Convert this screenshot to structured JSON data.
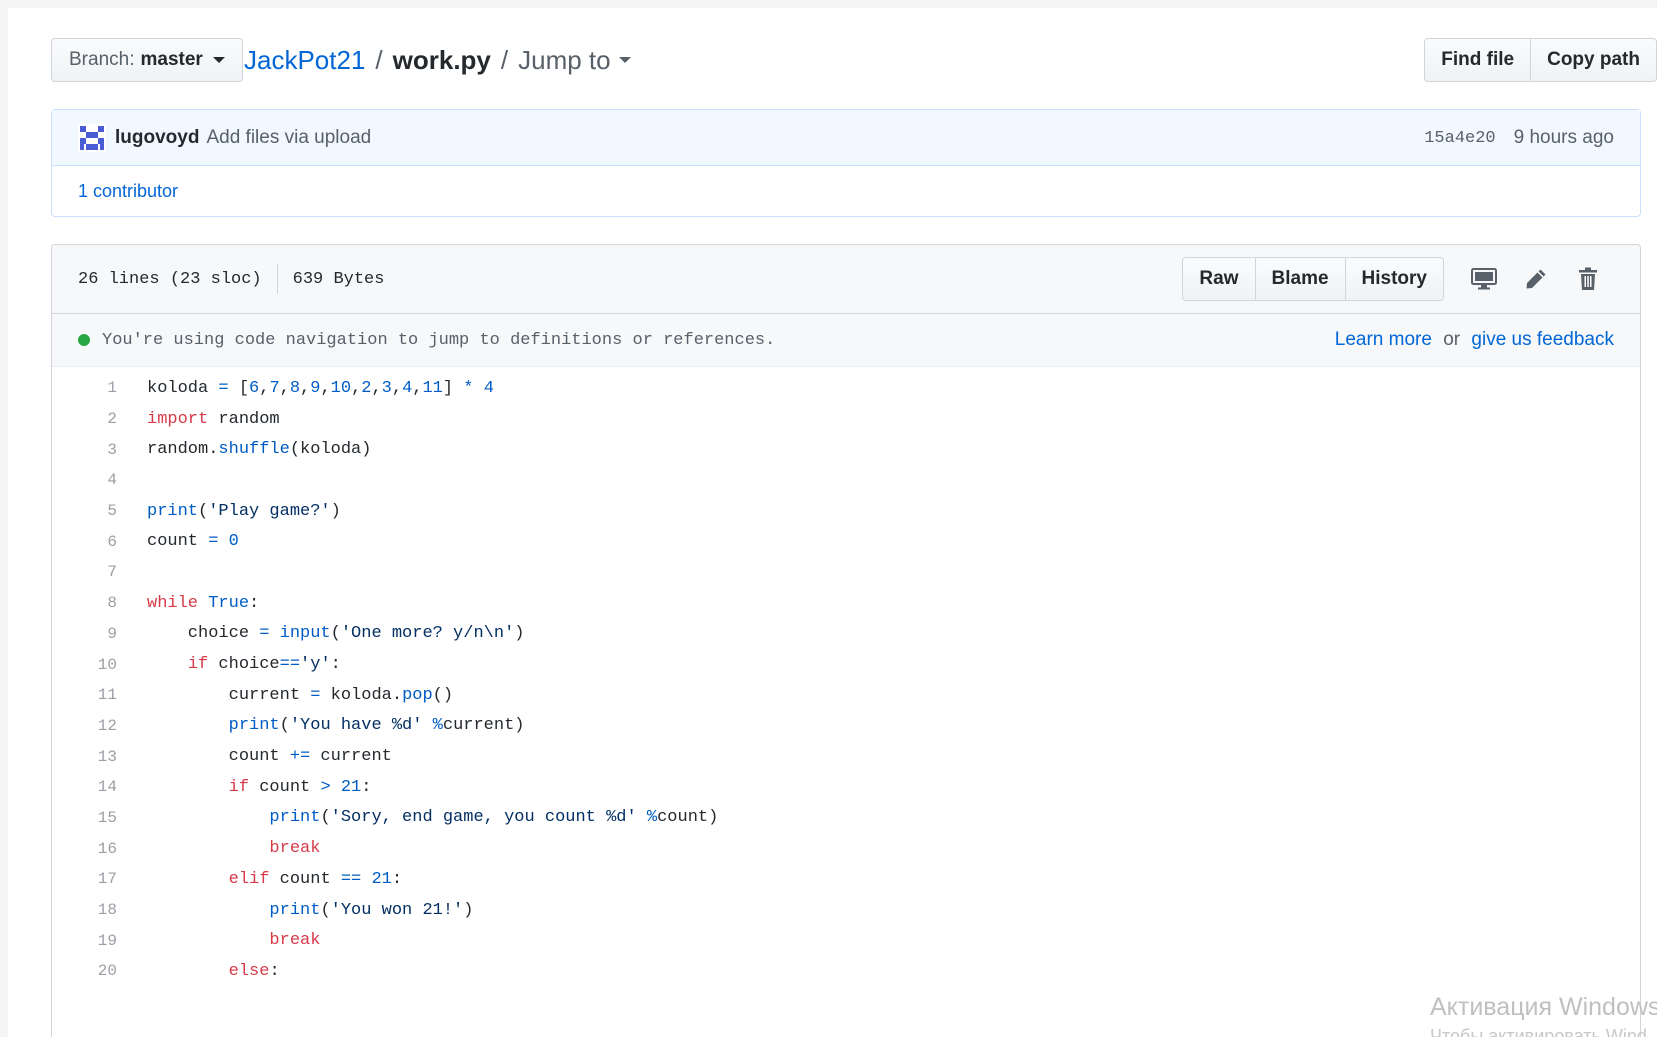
{
  "branch": {
    "label": "Branch:",
    "value": "master"
  },
  "breadcrumb": {
    "repo": "JackPot21",
    "sep1": "/",
    "file": "work.py",
    "sep2": "/",
    "jump": "Jump to"
  },
  "file_buttons": {
    "find": "Find file",
    "copy": "Copy path"
  },
  "commit": {
    "author": "lugovoyd",
    "message": "Add files via upload",
    "sha": "15a4e20",
    "time": "9 hours ago"
  },
  "contributors": "1 contributor",
  "file_info": {
    "lines": "26 lines (23 sloc)",
    "size": "639 Bytes"
  },
  "file_actions": {
    "raw": "Raw",
    "blame": "Blame",
    "history": "History"
  },
  "icons": {
    "desktop": "desktop-icon",
    "edit": "pencil-icon",
    "delete": "trash-icon"
  },
  "notice": {
    "text": "You're using code navigation to jump to definitions or references.",
    "learn": "Learn more",
    "or": "or",
    "feedback": "give us feedback"
  },
  "colors": {
    "link": "#0366d6",
    "keyword": "#d73a49",
    "number": "#005cc5",
    "string": "#032f62",
    "dot": "#28a745"
  },
  "code_lines": [
    {
      "n": "1",
      "tokens": [
        [
          "",
          "koloda "
        ],
        [
          "c1",
          "="
        ],
        [
          "",
          " ["
        ],
        [
          "c1",
          "6"
        ],
        [
          "",
          ","
        ],
        [
          "c1",
          "7"
        ],
        [
          "",
          ","
        ],
        [
          "c1",
          "8"
        ],
        [
          "",
          ","
        ],
        [
          "c1",
          "9"
        ],
        [
          "",
          ","
        ],
        [
          "c1",
          "10"
        ],
        [
          "",
          ","
        ],
        [
          "c1",
          "2"
        ],
        [
          "",
          ","
        ],
        [
          "c1",
          "3"
        ],
        [
          "",
          ","
        ],
        [
          "c1",
          "4"
        ],
        [
          "",
          ","
        ],
        [
          "c1",
          "11"
        ],
        [
          "",
          "] "
        ],
        [
          "c1",
          "*"
        ],
        [
          "",
          " "
        ],
        [
          "c1",
          "4"
        ]
      ]
    },
    {
      "n": "2",
      "tokens": [
        [
          "k",
          "import"
        ],
        [
          "",
          " random"
        ]
      ]
    },
    {
      "n": "3",
      "tokens": [
        [
          "",
          "random."
        ],
        [
          "c1",
          "shuffle"
        ],
        [
          "",
          "(koloda)"
        ]
      ]
    },
    {
      "n": "4",
      "tokens": []
    },
    {
      "n": "5",
      "tokens": [
        [
          "c1",
          "print"
        ],
        [
          "",
          "("
        ],
        [
          "s",
          "'Play game?'"
        ],
        [
          "",
          ")"
        ]
      ]
    },
    {
      "n": "6",
      "tokens": [
        [
          "",
          "count "
        ],
        [
          "c1",
          "="
        ],
        [
          "",
          " "
        ],
        [
          "c1",
          "0"
        ]
      ]
    },
    {
      "n": "7",
      "tokens": []
    },
    {
      "n": "8",
      "tokens": [
        [
          "k",
          "while"
        ],
        [
          "",
          " "
        ],
        [
          "c1",
          "True"
        ],
        [
          "",
          ":"
        ]
      ]
    },
    {
      "n": "9",
      "tokens": [
        [
          "",
          "    choice "
        ],
        [
          "c1",
          "="
        ],
        [
          "",
          " "
        ],
        [
          "c1",
          "input"
        ],
        [
          "",
          "("
        ],
        [
          "s",
          "'One more? y/n\\n'"
        ],
        [
          "",
          ")"
        ]
      ]
    },
    {
      "n": "10",
      "tokens": [
        [
          "",
          "    "
        ],
        [
          "k",
          "if"
        ],
        [
          "",
          " choice"
        ],
        [
          "c1",
          "=="
        ],
        [
          "s",
          "'y'"
        ],
        [
          "",
          ":"
        ]
      ]
    },
    {
      "n": "11",
      "tokens": [
        [
          "",
          "        current "
        ],
        [
          "c1",
          "="
        ],
        [
          "",
          " koloda."
        ],
        [
          "c1",
          "pop"
        ],
        [
          "",
          "()"
        ]
      ]
    },
    {
      "n": "12",
      "tokens": [
        [
          "",
          "        "
        ],
        [
          "c1",
          "print"
        ],
        [
          "",
          "("
        ],
        [
          "s",
          "'You have %d'"
        ],
        [
          "",
          " "
        ],
        [
          "c1",
          "%"
        ],
        [
          "",
          "current)"
        ]
      ]
    },
    {
      "n": "13",
      "tokens": [
        [
          "",
          "        count "
        ],
        [
          "c1",
          "+="
        ],
        [
          "",
          " current"
        ]
      ]
    },
    {
      "n": "14",
      "tokens": [
        [
          "",
          "        "
        ],
        [
          "k",
          "if"
        ],
        [
          "",
          " count "
        ],
        [
          "c1",
          ">"
        ],
        [
          "",
          " "
        ],
        [
          "c1",
          "21"
        ],
        [
          "",
          ":"
        ]
      ]
    },
    {
      "n": "15",
      "tokens": [
        [
          "",
          "            "
        ],
        [
          "c1",
          "print"
        ],
        [
          "",
          "("
        ],
        [
          "s",
          "'Sory, end game, you count %d'"
        ],
        [
          "",
          " "
        ],
        [
          "c1",
          "%"
        ],
        [
          "",
          "count)"
        ]
      ]
    },
    {
      "n": "16",
      "tokens": [
        [
          "",
          "            "
        ],
        [
          "k",
          "break"
        ]
      ]
    },
    {
      "n": "17",
      "tokens": [
        [
          "",
          "        "
        ],
        [
          "k",
          "elif"
        ],
        [
          "",
          " count "
        ],
        [
          "c1",
          "=="
        ],
        [
          "",
          " "
        ],
        [
          "c1",
          "21"
        ],
        [
          "",
          ":"
        ]
      ]
    },
    {
      "n": "18",
      "tokens": [
        [
          "",
          "            "
        ],
        [
          "c1",
          "print"
        ],
        [
          "",
          "("
        ],
        [
          "s",
          "'You won 21!'"
        ],
        [
          "",
          ")"
        ]
      ]
    },
    {
      "n": "19",
      "tokens": [
        [
          "",
          "            "
        ],
        [
          "k",
          "break"
        ]
      ]
    },
    {
      "n": "20",
      "tokens": [
        [
          "",
          "        "
        ],
        [
          "k",
          "else"
        ],
        [
          "",
          ":"
        ]
      ]
    }
  ],
  "watermark": {
    "line1": "Активация Windows",
    "line2": "Чтобы активировать Wind"
  }
}
